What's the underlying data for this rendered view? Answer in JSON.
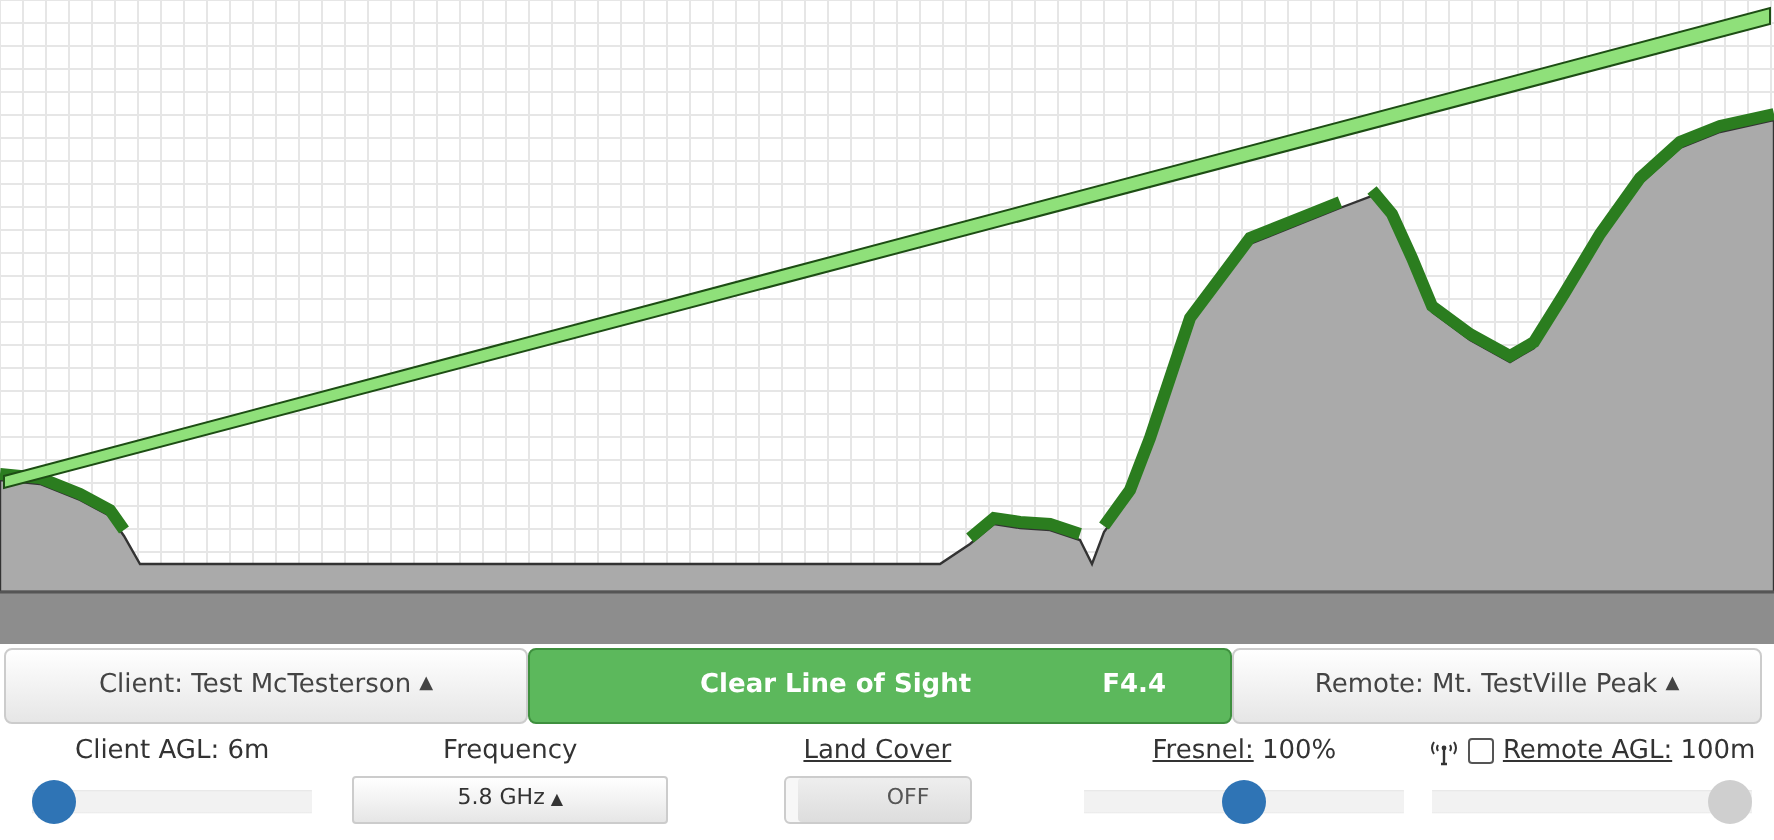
{
  "endpoints": {
    "client": {
      "label": "Client: Test McTesterson",
      "caret": "▲"
    },
    "status": {
      "kind": "clear",
      "text": "Clear Line of Sight",
      "reading": "F4.4"
    },
    "remote": {
      "label": "Remote: Mt. TestVille Peak",
      "caret": "▲"
    }
  },
  "controls": [
    {
      "kind": "slider",
      "label": "Client AGL: 6m",
      "underlined": false,
      "level": 0.0,
      "disabled": false
    },
    {
      "kind": "dropdown",
      "label": "Frequency",
      "value": "5.8 GHz",
      "caret": "▲"
    },
    {
      "kind": "toggle",
      "label": "Land Cover",
      "underlined": true,
      "value": "OFF",
      "on": false
    },
    {
      "kind": "slider",
      "label": "Fresnel:",
      "underlined": true,
      "reading": "100%",
      "level": 0.5,
      "disabled": false
    },
    {
      "kind": "slider",
      "label": "Remote AGL:",
      "underlined": true,
      "reading": "100m",
      "level": 1.0,
      "disabled": true,
      "checked": false
    }
  ]
}
